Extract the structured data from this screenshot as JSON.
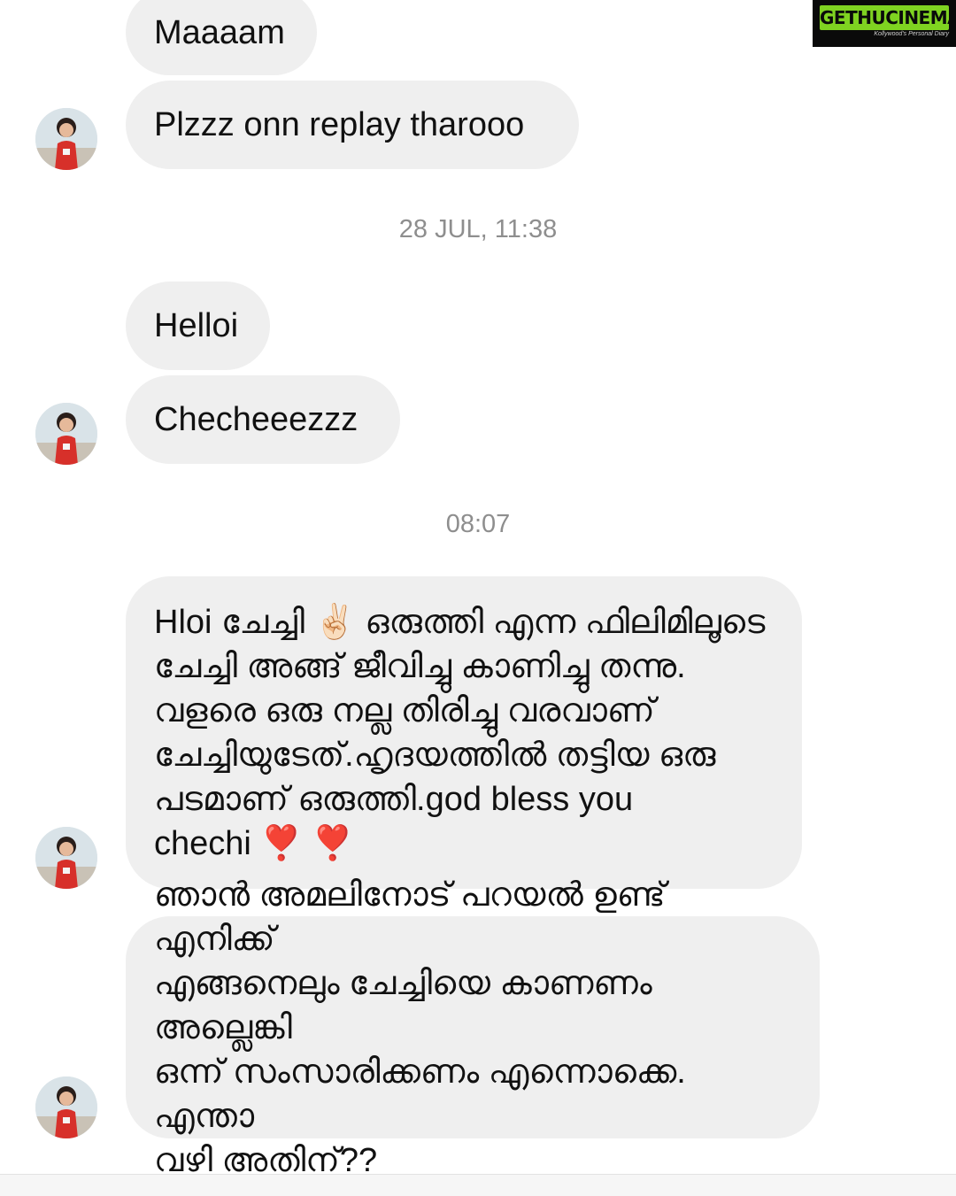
{
  "watermark": {
    "brand": "GETHUCINEMA",
    "tagline": "Kollywood's Personal Diary"
  },
  "messages": {
    "m1": "Maaaam",
    "m2": "Plzzz onn replay tharooo",
    "t1": "28 JUL, 11:38",
    "m3": "Helloi",
    "m4": "Checheeezzz",
    "t2": "08:07",
    "m5_lines": [
      "Hloi ചേച്ചി ✌🏻 ഒരുത്തി എന്ന ഫിലിമിലൂടെ",
      "ചേച്ചി അങ്ങ് ജീവിച്ചു കാണിച്ചു തന്നു.",
      "വളരെ ഒരു നല്ല തിരിച്ചു വരവാണ്",
      "ചേച്ചിയുടേത്.ഹൃദയത്തിൽ തട്ടിയ ഒരു",
      "പടമാണ് ഒരുത്തി.god bless you",
      "chechi ❣️ ❣️"
    ],
    "m6_lines": [
      "ഞാൻ അമലിനോട് പറയൽ ഉണ്ട് എനിക്ക്",
      "എങ്ങനെലും ചേച്ചിയെ കാണണം അല്ലെങ്കി",
      "ഒന്ന് സംസാരിക്കണം എന്നൊക്കെ. എന്താ",
      "വഴി അതിന്??"
    ]
  },
  "colors": {
    "bubble": "#efefef",
    "timestamp": "#8e8e8e",
    "logo_green": "#7fd321"
  }
}
